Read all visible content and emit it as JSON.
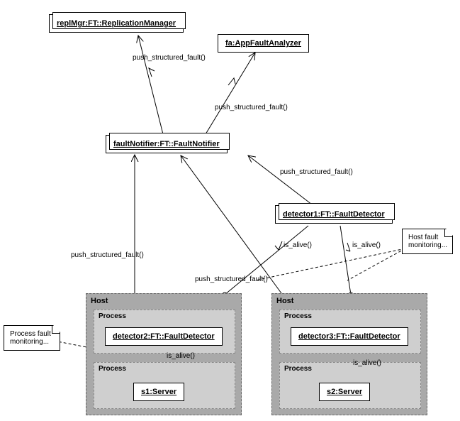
{
  "objects": {
    "replMgr": "replMgr:FT::ReplicationManager",
    "fa": "fa:AppFaultAnalyzer",
    "faultNotifier": "faultNotifier:FT::FaultNotifier",
    "detector1": "detector1:FT::FaultDetector",
    "detector2": "detector2:FT::FaultDetector",
    "detector3": "detector3:FT::FaultDetector",
    "s1": "s1:Server",
    "s2": "s2:Server"
  },
  "containers": {
    "hostLabel": "Host",
    "processLabel": "Process"
  },
  "notes": {
    "hostFault": "Host fault monitoring...",
    "processFault": "Process fault monitoring..."
  },
  "messages": {
    "push_structured_fault": "push_structured_fault()",
    "is_alive": "is_alive()"
  },
  "chart_data": {
    "type": "uml-collaboration-diagram",
    "objects": [
      {
        "id": "replMgr",
        "label": "replMgr:FT::ReplicationManager",
        "stacked": true
      },
      {
        "id": "fa",
        "label": "fa:AppFaultAnalyzer"
      },
      {
        "id": "faultNotifier",
        "label": "faultNotifier:FT::FaultNotifier",
        "stacked": true
      },
      {
        "id": "detector1",
        "label": "detector1:FT::FaultDetector",
        "stacked": true
      },
      {
        "id": "detector2",
        "label": "detector2:FT::FaultDetector",
        "container": "host1.process1"
      },
      {
        "id": "detector3",
        "label": "detector3:FT::FaultDetector",
        "container": "host2.process1"
      },
      {
        "id": "s1",
        "label": "s1:Server",
        "container": "host1.process2"
      },
      {
        "id": "s2",
        "label": "s2:Server",
        "container": "host2.process2"
      }
    ],
    "containers": [
      {
        "id": "host1",
        "type": "Host",
        "children": [
          "process1",
          "process2"
        ]
      },
      {
        "id": "host2",
        "type": "Host",
        "children": [
          "process1",
          "process2"
        ]
      }
    ],
    "messages": [
      {
        "from": "faultNotifier",
        "to": "replMgr",
        "label": "push_structured_fault()"
      },
      {
        "from": "faultNotifier",
        "to": "fa",
        "label": "push_structured_fault()"
      },
      {
        "from": "detector1",
        "to": "faultNotifier",
        "label": "push_structured_fault()"
      },
      {
        "from": "detector2",
        "to": "faultNotifier",
        "label": "push_structured_fault()"
      },
      {
        "from": "detector3",
        "to": "faultNotifier",
        "label": "push_structured_fault()"
      },
      {
        "from": "detector1",
        "to": "host1",
        "label": "is_alive()"
      },
      {
        "from": "detector1",
        "to": "host2",
        "label": "is_alive()"
      },
      {
        "from": "detector2",
        "to": "s1",
        "label": "is_alive()"
      },
      {
        "from": "detector3",
        "to": "s2",
        "label": "is_alive()"
      }
    ],
    "notes": [
      {
        "text": "Host fault monitoring...",
        "attachedTo": [
          "detector1->host1",
          "detector1->host2"
        ]
      },
      {
        "text": "Process fault monitoring...",
        "attachedTo": [
          "detector2->s1"
        ]
      }
    ]
  }
}
